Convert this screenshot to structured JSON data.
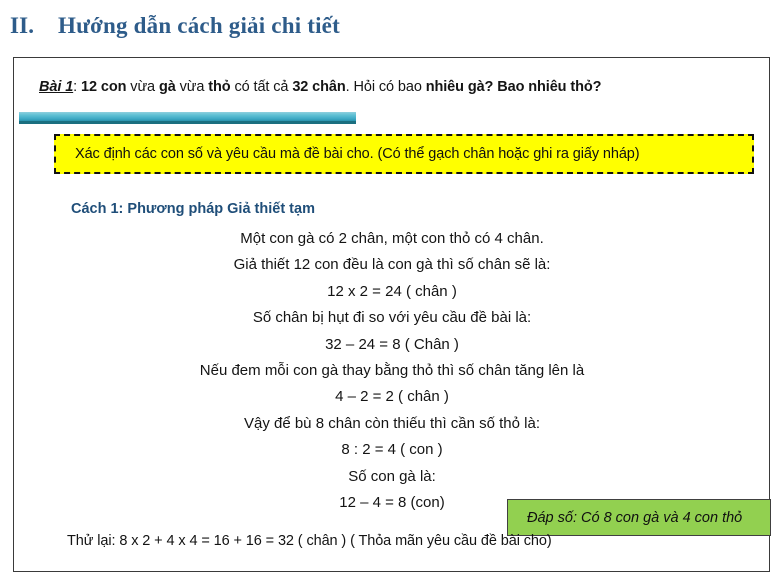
{
  "section": {
    "numeral": "II.",
    "title": "Hướng dẫn cách giải chi tiết"
  },
  "problem": {
    "label": "Bài 1",
    "seg1": ": ",
    "seg2": "12 con",
    "seg3": " vừa ",
    "seg4": "gà",
    "seg5": " vừa ",
    "seg6": "thỏ",
    "seg7": " có tất cả ",
    "seg8": "32 chân",
    "seg9": ". Hỏi có bao ",
    "seg10": "nhiêu gà? Bao nhiêu thỏ?"
  },
  "callout": {
    "text": "Xác định các con số và yêu cầu mà đề bài cho. (Có thể gạch chân hoặc ghi ra giấy nháp)"
  },
  "method": {
    "heading": "Cách 1: Phương pháp Giả thiết tạm"
  },
  "solution": {
    "lines": [
      "Một con gà có 2 chân, một con thỏ có 4 chân.",
      "Giả thiết 12 con đều là con gà thì số chân sẽ là:",
      "12 x 2 = 24 ( chân )",
      "Số chân bị hụt đi so với yêu cầu đề bài là:",
      "32 – 24 = 8 ( Chân )",
      "Nếu đem mỗi con gà thay bằng thỏ thì số chân tăng lên là",
      "4 – 2 = 2 ( chân )",
      "Vậy để bù 8 chân còn thiếu thì cần số thỏ là:",
      "8 : 2 = 4 ( con )",
      "Số con gà là:",
      "12 – 4 = 8 (con)"
    ]
  },
  "answer": {
    "text": "Đáp số: Có 8 con gà và 4 con thỏ"
  },
  "check": {
    "text": "Thử lại: 8 x 2 + 4 x 4 = 16 + 16 = 32 ( chân ) ( Thỏa mãn yêu cầu đề bài cho)"
  },
  "colors": {
    "heading_blue": "#2e5c8a",
    "method_blue": "#1f4e79",
    "bar_top": "#8fd0de",
    "bar_bottom": "#2a93ae",
    "bar_edge": "#1b6f80",
    "highlight_yellow": "#ffff00",
    "answer_green": "#92d050",
    "frame_border": "#3a3a3a"
  }
}
